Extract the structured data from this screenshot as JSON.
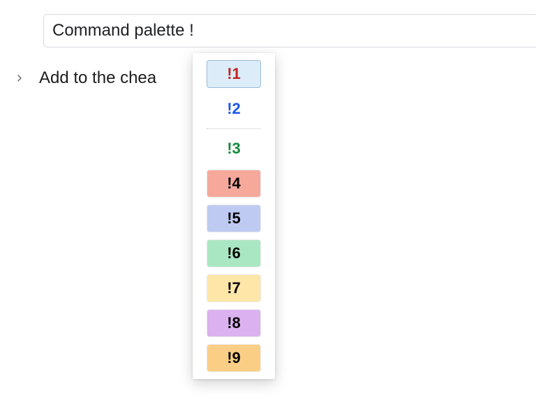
{
  "input": {
    "value": "Command palette !"
  },
  "row": {
    "label": "Add to the chea"
  },
  "menu": {
    "selected_index": 0,
    "items": [
      {
        "label": "!1",
        "text_color": "#c5221f",
        "bg": "#dcecf8",
        "border": "#9bbcd6",
        "style": "box"
      },
      {
        "label": "!2",
        "text_color": "#1a56e8",
        "bg": "transparent",
        "style": "text"
      },
      {
        "label": "!3",
        "text_color": "#138a3a",
        "bg": "transparent",
        "style": "text"
      },
      {
        "label": "!4",
        "text_color": "#000000",
        "bg": "#f6a99b",
        "border": "#eaeaea",
        "style": "box"
      },
      {
        "label": "!5",
        "text_color": "#000000",
        "bg": "#bfcaf2",
        "border": "#eaeaea",
        "style": "box"
      },
      {
        "label": "!6",
        "text_color": "#000000",
        "bg": "#a9e7c2",
        "border": "#eaeaea",
        "style": "box"
      },
      {
        "label": "!7",
        "text_color": "#000000",
        "bg": "#fde6a8",
        "border": "#eaeaea",
        "style": "box"
      },
      {
        "label": "!8",
        "text_color": "#000000",
        "bg": "#dcb1ef",
        "border": "#eaeaea",
        "style": "box"
      },
      {
        "label": "!9",
        "text_color": "#000000",
        "bg": "#fbce86",
        "border": "#eaeaea",
        "style": "box"
      }
    ]
  }
}
